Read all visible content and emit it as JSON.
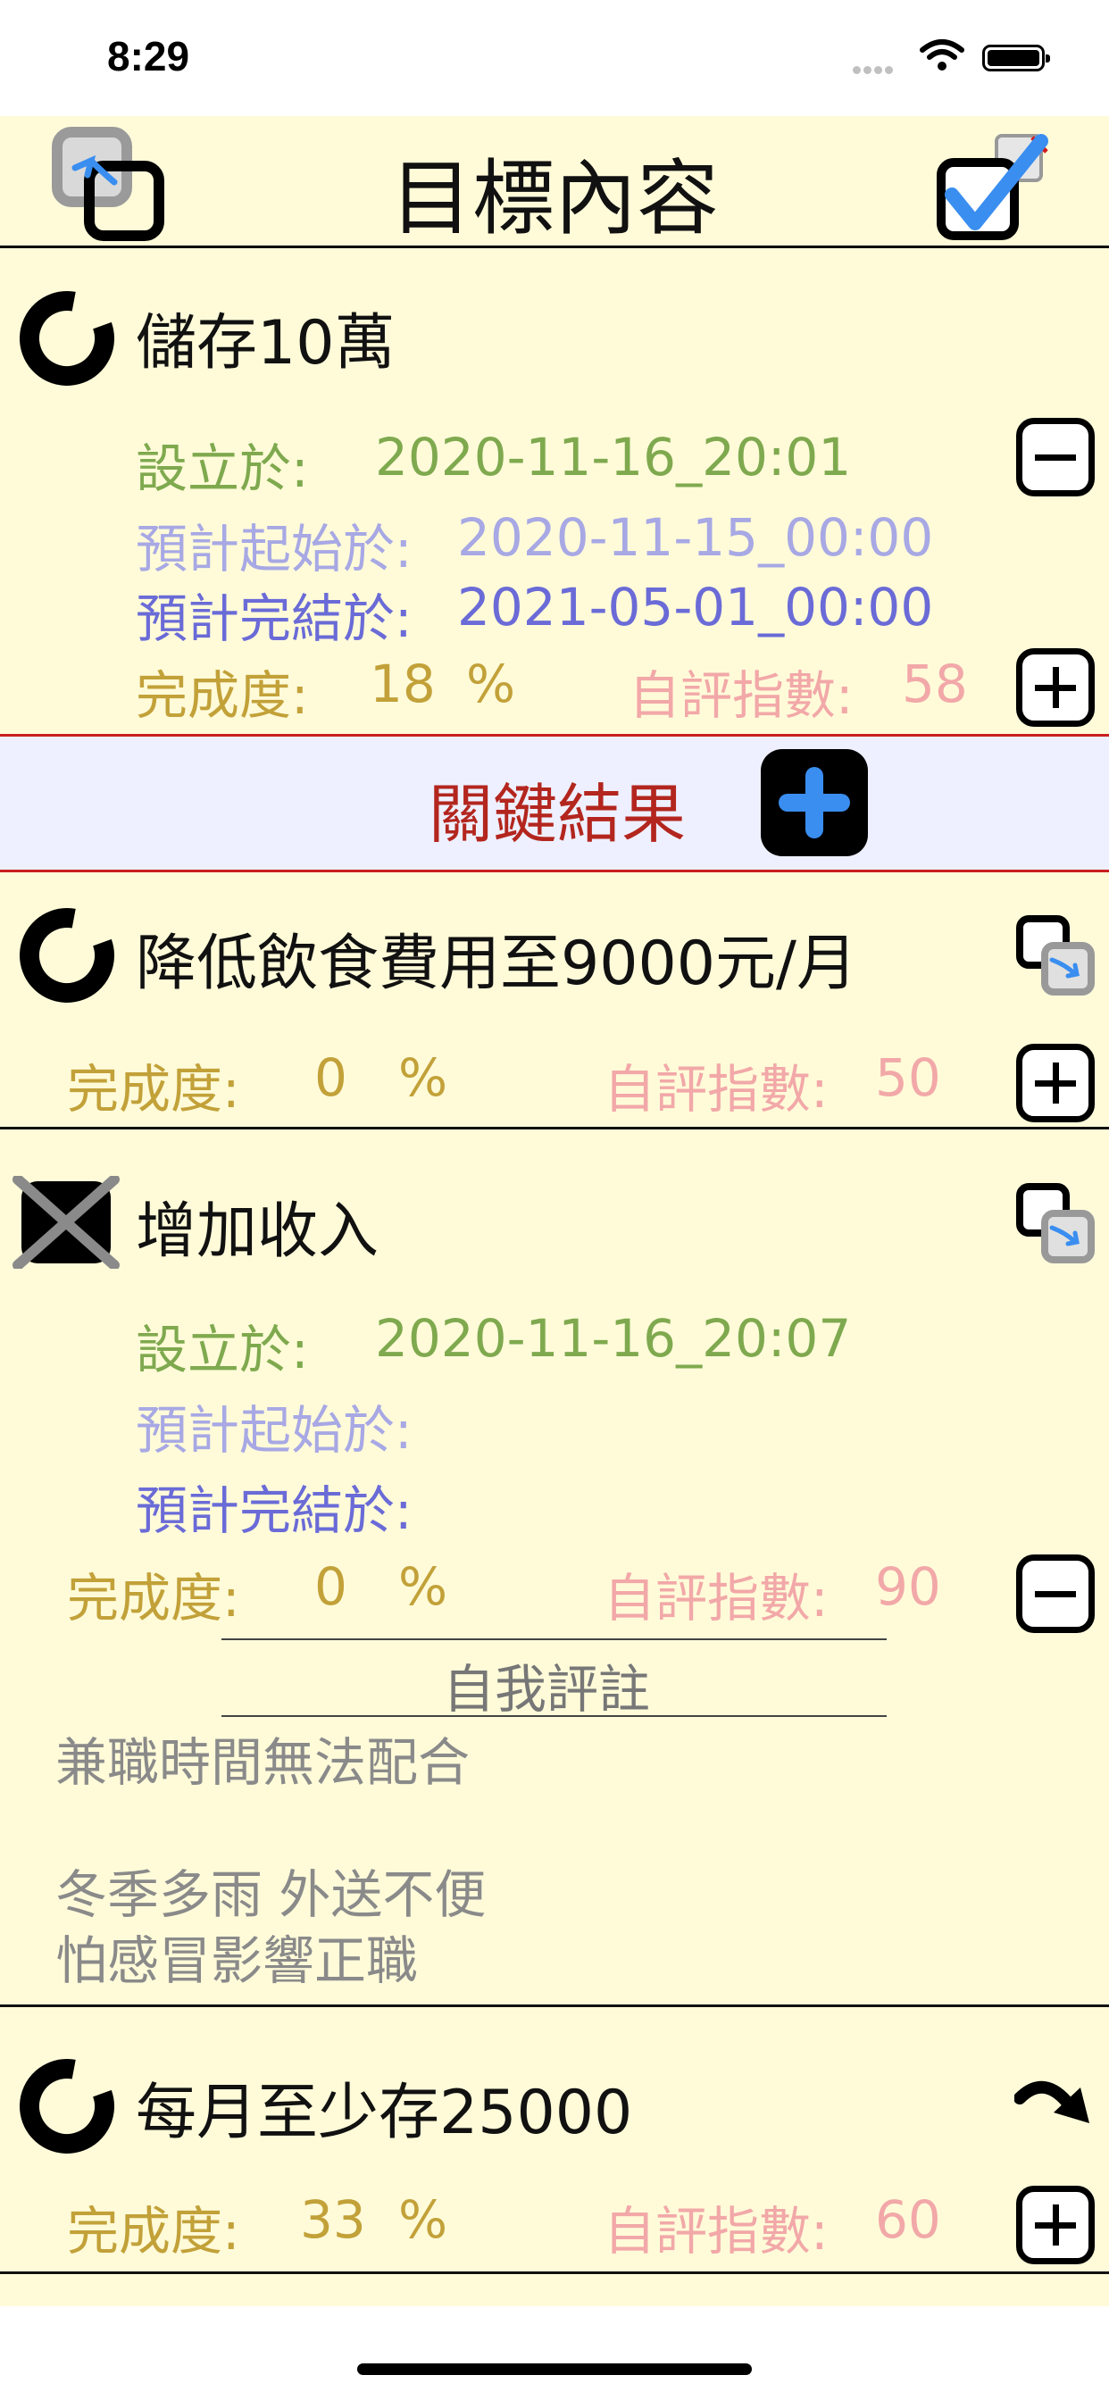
{
  "status_bar": {
    "time": "8:29"
  },
  "header": {
    "title": "目標內容"
  },
  "objective": {
    "title": "儲存10萬",
    "created_label": "設立於:",
    "created_value": "2020-11-16_20:01",
    "start_label": "預計起始於:",
    "start_value": "2020-11-15_00:00",
    "end_label": "預計完結於:",
    "end_value": "2021-05-01_00:00",
    "progress_label": "完成度:",
    "progress_value": "18",
    "progress_unit": "%",
    "score_label": "自評指數:",
    "score_value": "58"
  },
  "key_results_header": {
    "title": "關鍵結果"
  },
  "key_results": [
    {
      "title": "降低飲食費用至9000元/月",
      "progress_label": "完成度:",
      "progress_value": "0",
      "progress_unit": "%",
      "score_label": "自評指數:",
      "score_value": "50"
    },
    {
      "title": "增加收入",
      "created_label": "設立於:",
      "created_value": "2020-11-16_20:07",
      "start_label": "預計起始於:",
      "end_label": "預計完結於:",
      "progress_label": "完成度:",
      "progress_value": "0",
      "progress_unit": "%",
      "score_label": "自評指數:",
      "score_value": "90",
      "note_heading": "自我評註",
      "note_text": "兼職時間無法配合\n\n冬季多雨 外送不便\n怕感冒影響正職"
    },
    {
      "title": "每月至少存25000",
      "progress_label": "完成度:",
      "progress_value": "33",
      "progress_unit": "%",
      "score_label": "自評指數:",
      "score_value": "60"
    }
  ],
  "colors": {
    "background": "#fffbd9",
    "created": "#7fa94e",
    "start": "#a7a8e4",
    "end": "#6a6bd7",
    "progress": "#c2a139",
    "score": "#f2a8a8",
    "key_results_title": "#b3261e",
    "accent_blue": "#3a8ef0"
  }
}
